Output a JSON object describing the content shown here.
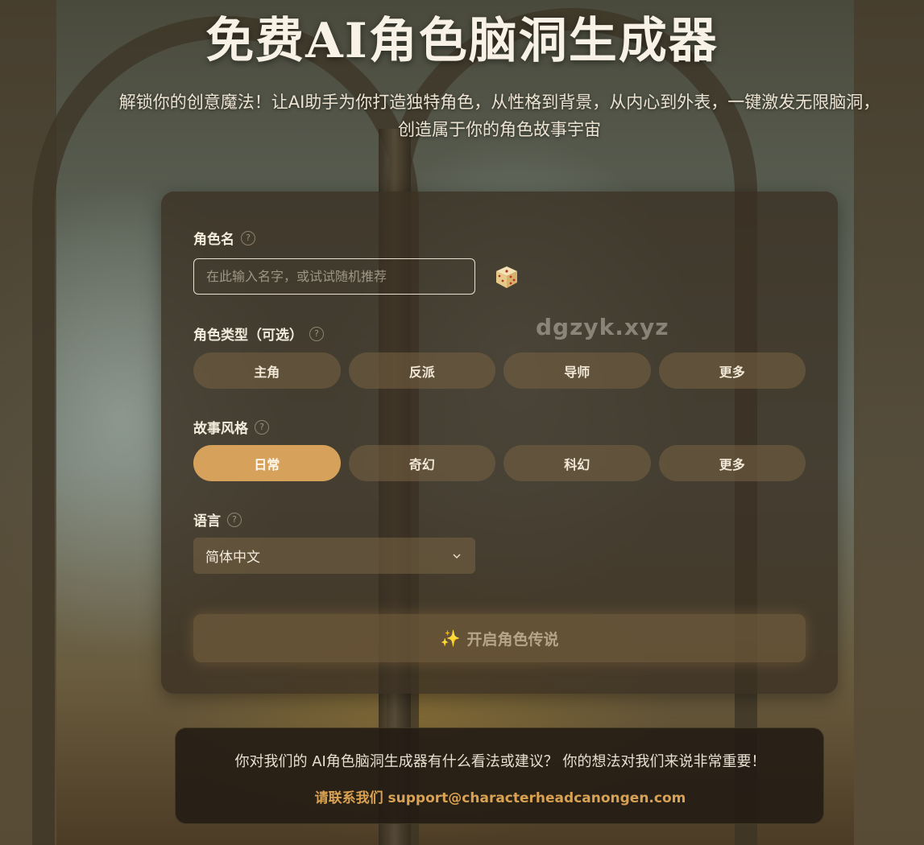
{
  "header": {
    "title": "免费AI角色脑洞生成器",
    "subtitle": "解锁你的创意魔法！让AI助手为你打造独特角色，从性格到背景，从内心到外表，一键激发无限脑洞，创造属于你的角色故事宇宙"
  },
  "form": {
    "name": {
      "label": "角色名",
      "placeholder": "在此输入名字，或试试随机推荐",
      "value": ""
    },
    "character_type": {
      "label": "角色类型（可选）",
      "options": [
        "主角",
        "反派",
        "导师",
        "更多"
      ],
      "selected": null
    },
    "story_style": {
      "label": "故事风格",
      "options": [
        "日常",
        "奇幻",
        "科幻",
        "更多"
      ],
      "selected": "日常"
    },
    "language": {
      "label": "语言",
      "selected": "简体中文"
    },
    "start_button": {
      "icon": "sparkle-icon",
      "label": "开启角色传说"
    }
  },
  "watermark": "dgzyk.xyz",
  "feedback": {
    "text": "你对我们的 AI角色脑洞生成器有什么看法或建议？ 你的想法对我们来说非常重要！",
    "contact_prefix": "请联系我们",
    "email": "support@characterheadcanongen.com"
  },
  "colors": {
    "accent": "#d6a25b",
    "panel": "#3a3022",
    "contact_link": "#d9a253"
  }
}
